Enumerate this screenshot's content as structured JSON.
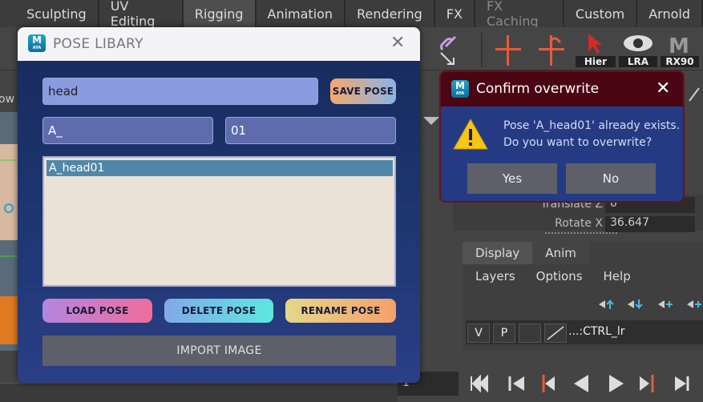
{
  "maya": {
    "tabs": [
      "Sculpting",
      "UV Editing",
      "Rigging",
      "Animation",
      "Rendering",
      "FX",
      "FX Caching",
      "Custom",
      "Arnold"
    ],
    "active_tab": "Rigging",
    "shelf_labels": [
      "Hier",
      "LRA",
      "RX90"
    ],
    "channel_box": [
      {
        "label": "Translate Z",
        "value": "0"
      },
      {
        "label": "Rotate X",
        "value": "36.647"
      }
    ],
    "layer_tabs": [
      "Display",
      "Anim"
    ],
    "layer_menu": [
      "Layers",
      "Options",
      "Help"
    ],
    "layer_row": {
      "v": "V",
      "p": "P",
      "name": "...:CTRL_lr"
    },
    "frame_field": "1",
    "left_partial_text": "ow"
  },
  "pose_dialog": {
    "logo_letter": "M",
    "logo_sub": "AYA",
    "title": "POSE LIBARY",
    "name_field": "head",
    "prefix_field": "A_",
    "index_field": "01",
    "save_button": "SAVE POSE",
    "list_items": [
      "A_head01"
    ],
    "load_button": "LOAD POSE",
    "delete_button": "DELETE POSE",
    "rename_button": "RENAME POSE",
    "import_button": "IMPORT IMAGE"
  },
  "confirm_dialog": {
    "title": "Confirm overwrite",
    "message_line1": "Pose 'A_head01' already exists.",
    "message_line2": "Do you want to overwrite?",
    "yes_button": "Yes",
    "no_button": "No"
  },
  "colors": {
    "dialog_gradient_top": "#162a5a",
    "dialog_gradient_bottom": "#2a3f85",
    "confirm_title_bar": "#4a0612",
    "list_selection": "#5087a8"
  }
}
